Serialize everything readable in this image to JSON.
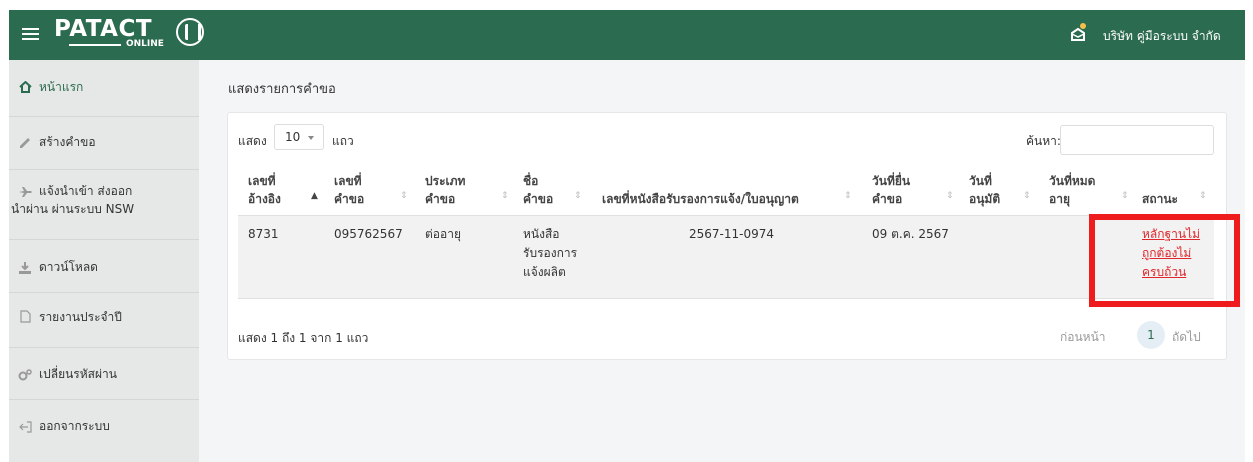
{
  "header": {
    "logo_text": "PATACT",
    "logo_sub": "ONLINE",
    "company": "บริษัท คู่มือระบบ จำกัด"
  },
  "sidebar": {
    "items": [
      {
        "label": "หน้าแรก",
        "icon": "home-icon"
      },
      {
        "label": "สร้างคำขอ",
        "icon": "pencil-icon"
      },
      {
        "label": "แจ้งนำเข้า ส่งออก",
        "label2": "นำผ่าน ผ่านระบบ NSW",
        "icon": "airplane-icon"
      },
      {
        "label": "ดาวน์โหลด",
        "icon": "download-icon"
      },
      {
        "label": "รายงานประจำปี",
        "icon": "file-icon"
      },
      {
        "label": "เปลี่ยนรหัสผ่าน",
        "icon": "gears-icon"
      },
      {
        "label": "ออกจากระบบ",
        "icon": "logout-icon"
      }
    ]
  },
  "main": {
    "title": "แสดงรายการคำขอ",
    "length": {
      "prefix": "แสดง",
      "value": "10",
      "suffix": "แถว"
    },
    "search": {
      "label": "ค้นหา:",
      "value": ""
    },
    "columns": [
      {
        "line1": "เลขที่",
        "line2": "อ้างอิง"
      },
      {
        "line1": "เลขที่",
        "line2": "คำขอ"
      },
      {
        "line1": "ประเภท",
        "line2": "คำขอ"
      },
      {
        "line1": "ชื่อ",
        "line2": "คำขอ"
      },
      {
        "line1": "",
        "line2": "เลขที่หนังสือรับรองการแจ้ง/ใบอนุญาต"
      },
      {
        "line1": "วันที่ยื่น",
        "line2": "คำขอ"
      },
      {
        "line1": "วันที่",
        "line2": "อนุมัติ"
      },
      {
        "line1": "วันที่หมด",
        "line2": "อายุ"
      },
      {
        "line1": "",
        "line2": "สถานะ"
      }
    ],
    "rows": [
      {
        "ref_no": "8731",
        "request_no": "095762567",
        "request_type": "ต่ออายุ",
        "request_name": [
          "หนังสือ",
          "รับรองการ",
          "แจ้งผลิต"
        ],
        "cert_no": "2567-11-0974",
        "submit_date": "09 ต.ค. 2567",
        "approve_date": "",
        "expire_date": "",
        "status": [
          "หลักฐานไม่",
          "ถูกต้องไม่",
          "ครบถ้วน"
        ]
      }
    ],
    "info": "แสดง 1 ถึง 1 จาก 1 แถว",
    "pager": {
      "prev": "ก่อนหน้า",
      "current": "1",
      "next": "ถัดไป"
    }
  },
  "colors": {
    "header_bg": "#2b6b4f",
    "sidebar_bg": "#e5e8e6",
    "status_red": "#e0262b",
    "highlight": "#ee1c1c"
  }
}
